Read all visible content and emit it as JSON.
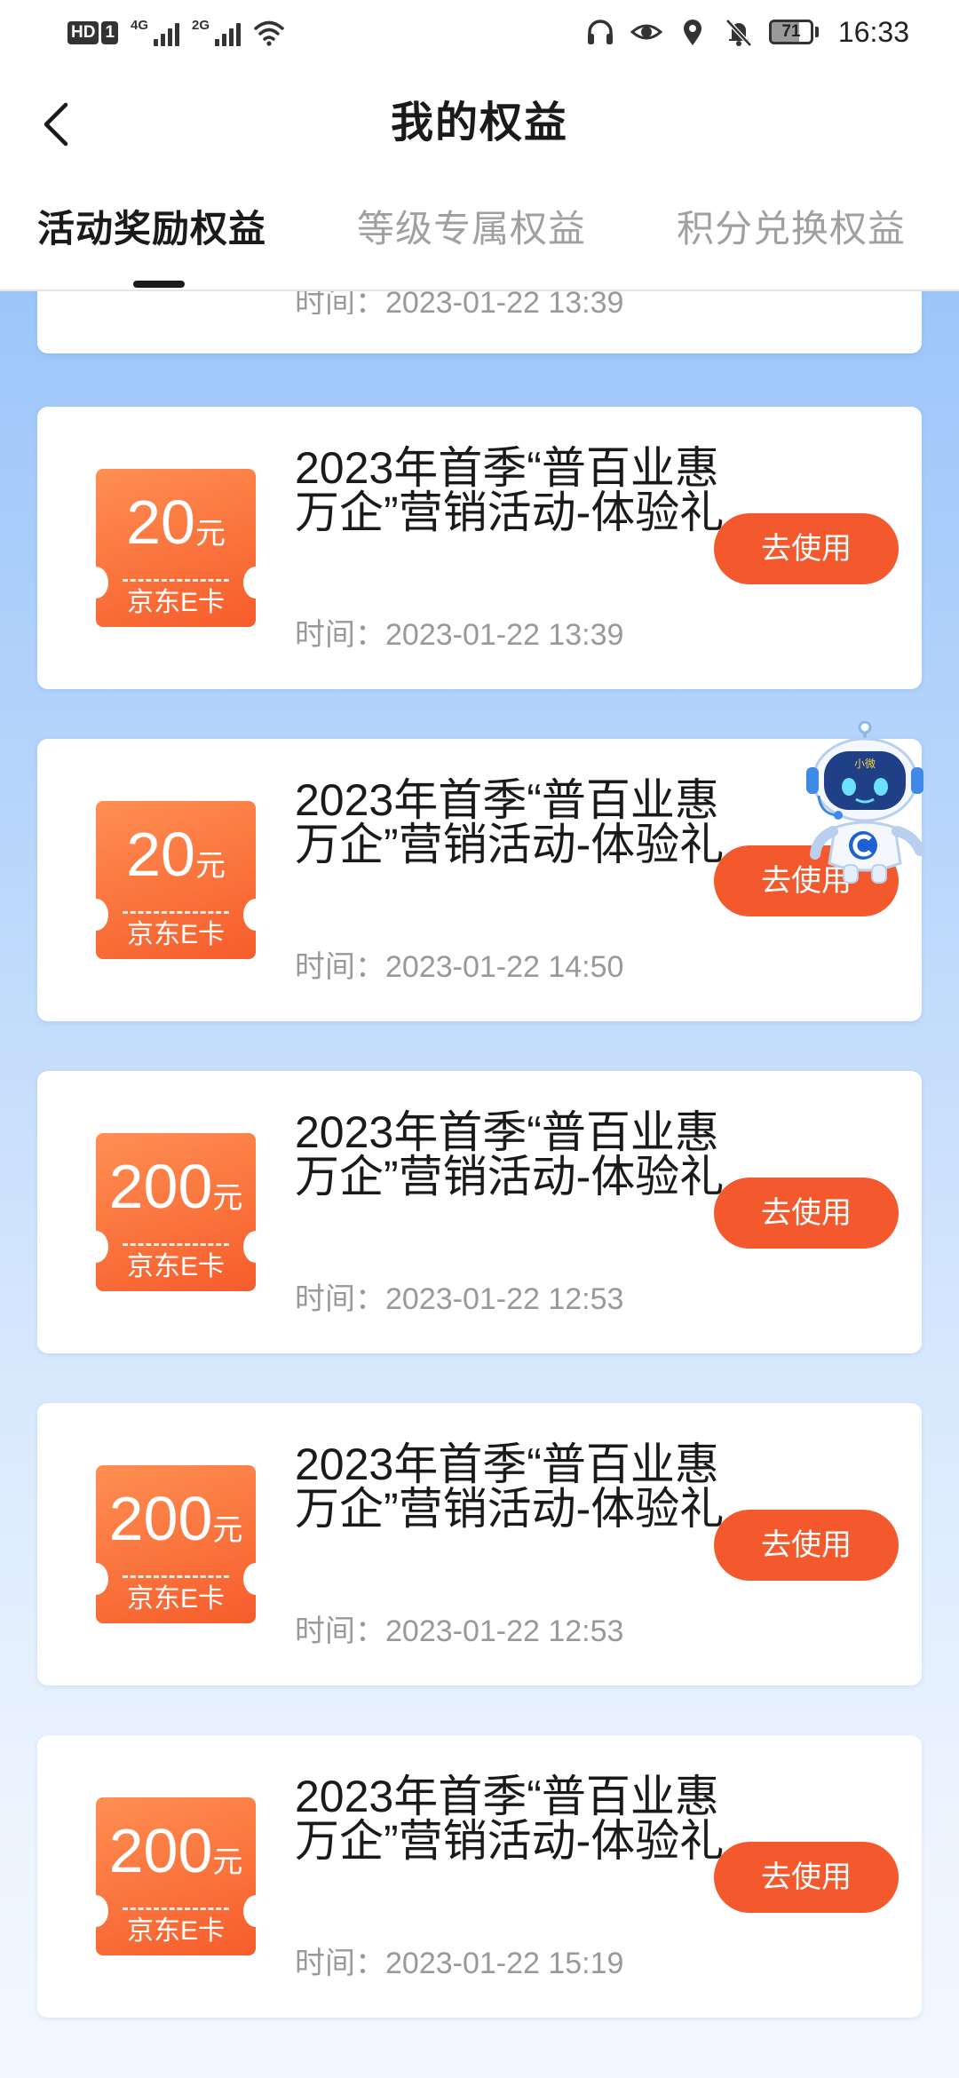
{
  "status_bar": {
    "hd_label": "HD",
    "sim_label": "1",
    "sim1_generation": "4G",
    "sim2_generation": "2G",
    "battery_level": "71",
    "battery_fraction": 0.71,
    "time": "16:33",
    "icons": [
      "headphones-icon",
      "eye-icon",
      "location-icon",
      "mute-bell-icon",
      "battery-icon"
    ]
  },
  "header": {
    "back_icon": "chevron-left-icon",
    "title": "我的权益"
  },
  "tabs": [
    {
      "label": "活动奖励权益",
      "active": true
    },
    {
      "label": "等级专属权益",
      "active": false
    },
    {
      "label": "积分兑换权益",
      "active": false
    }
  ],
  "partial_card": {
    "time": "时间：2023-01-22 13:39"
  },
  "coupons": [
    {
      "amount": "20",
      "unit": "元",
      "card_type": "京东E卡",
      "name": "2023年首季“普百业惠万企”营销活动-体验礼",
      "time": "时间：2023-01-22 13:39",
      "button": "去使用"
    },
    {
      "amount": "20",
      "unit": "元",
      "card_type": "京东E卡",
      "name": "2023年首季“普百业惠万企”营销活动-体验礼",
      "time": "时间：2023-01-22 14:50",
      "button": "去使用"
    },
    {
      "amount": "200",
      "unit": "元",
      "card_type": "京东E卡",
      "name": "2023年首季“普百业惠万企”营销活动-体验礼",
      "time": "时间：2023-01-22 12:53",
      "button": "去使用"
    },
    {
      "amount": "200",
      "unit": "元",
      "card_type": "京东E卡",
      "name": "2023年首季“普百业惠万企”营销活动-体验礼",
      "time": "时间：2023-01-22 12:53",
      "button": "去使用"
    },
    {
      "amount": "200",
      "unit": "元",
      "card_type": "京东E卡",
      "name": "2023年首季“普百业惠万企”营销活动-体验礼",
      "time": "时间：2023-01-22 15:19",
      "button": "去使用"
    }
  ],
  "assistant": {
    "badge_text": "小微",
    "icon": "robot-assistant-icon"
  },
  "colors": {
    "accent": "#f4592d",
    "ticket_start": "#ff8f52",
    "ticket_end": "#f65c2c",
    "background_top": "#9cc6fa",
    "background_bottom": "#f3f8fe"
  }
}
